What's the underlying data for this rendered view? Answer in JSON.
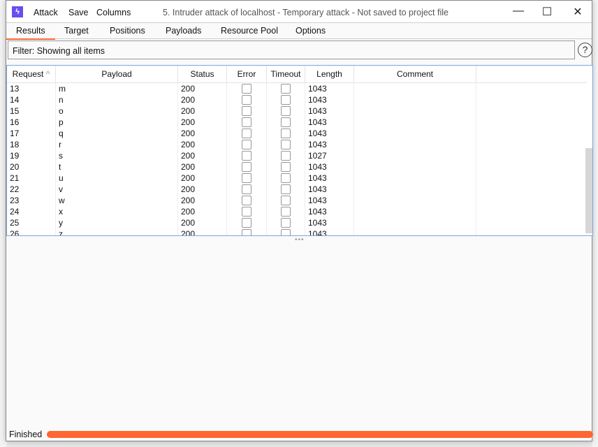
{
  "window": {
    "title": "5. Intruder attack of localhost - Temporary attack - Not saved to project file",
    "menu": [
      "Attack",
      "Save",
      "Columns"
    ]
  },
  "tabs": [
    "Results",
    "Target",
    "Positions",
    "Payloads",
    "Resource Pool",
    "Options"
  ],
  "active_tab": "Results",
  "filter": "Filter: Showing all items",
  "table": {
    "columns": [
      "Request",
      "Payload",
      "Status",
      "Error",
      "Timeout",
      "Length",
      "Comment"
    ],
    "sort": "Request ascending",
    "rows": [
      [
        "13",
        "m",
        "200",
        "1043"
      ],
      [
        "14",
        "n",
        "200",
        "1043"
      ],
      [
        "15",
        "o",
        "200",
        "1043"
      ],
      [
        "16",
        "p",
        "200",
        "1043"
      ],
      [
        "17",
        "q",
        "200",
        "1043"
      ],
      [
        "18",
        "r",
        "200",
        "1043"
      ],
      [
        "19",
        "s",
        "200",
        "1027"
      ],
      [
        "20",
        "t",
        "200",
        "1043"
      ],
      [
        "21",
        "u",
        "200",
        "1043"
      ],
      [
        "22",
        "v",
        "200",
        "1043"
      ],
      [
        "23",
        "w",
        "200",
        "1043"
      ],
      [
        "24",
        "x",
        "200",
        "1043"
      ],
      [
        "25",
        "y",
        "200",
        "1043"
      ],
      [
        "26",
        "z",
        "200",
        "1043"
      ]
    ]
  },
  "status": {
    "text": "Finished",
    "progress_percent": 100,
    "color": "#ff6633"
  }
}
